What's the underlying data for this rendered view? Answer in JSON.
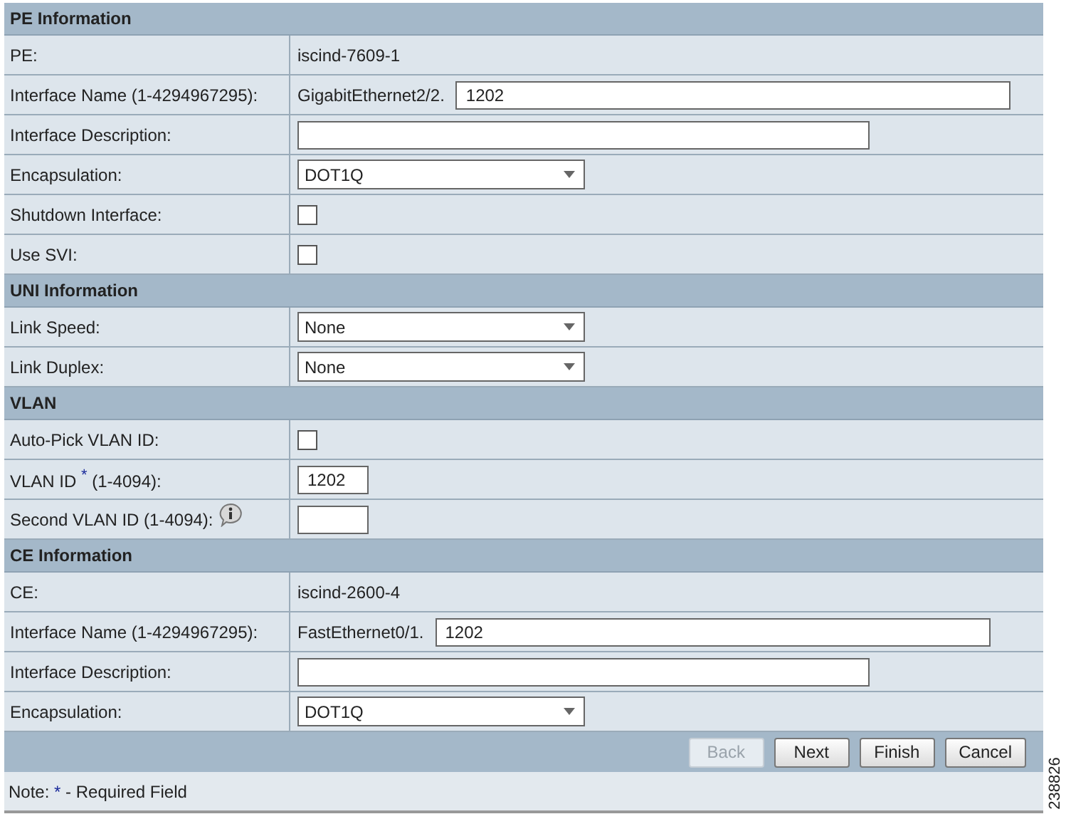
{
  "sections": [
    {
      "title": "PE Information",
      "rows": [
        {
          "kind": "text",
          "label": "PE:",
          "value": "iscind-7609-1"
        },
        {
          "kind": "prefixed_input",
          "label": "Interface Name (1-4294967295):",
          "prefix": "GigabitEthernet2/2.",
          "value": "1202"
        },
        {
          "kind": "input",
          "label": "Interface Description:"
        },
        {
          "kind": "select",
          "label": "Encapsulation:",
          "value": "DOT1Q"
        },
        {
          "kind": "checkbox",
          "label": "Shutdown Interface:",
          "checked": false
        },
        {
          "kind": "checkbox",
          "label": "Use SVI:",
          "checked": false
        }
      ]
    },
    {
      "title": "UNI Information",
      "rows": [
        {
          "kind": "select",
          "label": "Link Speed:",
          "value": "None"
        },
        {
          "kind": "select",
          "label": "Link Duplex:",
          "value": "None"
        }
      ]
    },
    {
      "title": "VLAN",
      "rows": [
        {
          "kind": "checkbox",
          "label": "Auto-Pick VLAN ID:",
          "checked": false
        },
        {
          "kind": "short_input",
          "label": "VLAN ID $^{*}$ (1-4094):",
          "value": "1202"
        },
        {
          "kind": "short_input",
          "label": "Second VLAN ID (1-4094):",
          "info": true
        }
      ]
    },
    {
      "title": "CE Information",
      "rows": [
        {
          "kind": "text",
          "label": "CE:",
          "value": "iscind-2600-4"
        },
        {
          "kind": "prefixed_input",
          "label": "Interface Name (1-4294967295):",
          "prefix": "FastEthernet0/1.",
          "value": "1202"
        },
        {
          "kind": "input",
          "label": "Interface Description:"
        },
        {
          "kind": "select",
          "label": "Encapsulation:",
          "value": "DOT1Q"
        }
      ]
    }
  ],
  "buttons": [
    {
      "label": "Back",
      "disabled": true
    },
    {
      "label": "Next",
      "disabled": false
    },
    {
      "label": "Finish",
      "disabled": false
    },
    {
      "label": "Cancel",
      "disabled": false
    }
  ],
  "note": {
    "lead": "Note:",
    "mark": "*",
    "text": "- Required Field"
  },
  "figure_id": "238826"
}
